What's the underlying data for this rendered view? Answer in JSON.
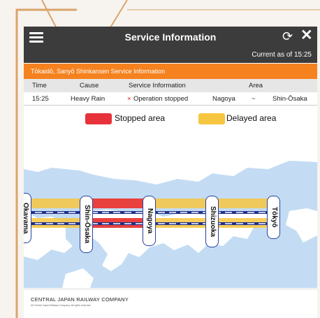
{
  "header": {
    "title": "Service Information",
    "as_of": "Current as of 15:25",
    "menu_icon": "hamburger-icon",
    "refresh_icon": "refresh-icon",
    "close_icon": "close-icon",
    "bg_color": "#3c3c3c"
  },
  "banner": {
    "text": "Tōkaidō, Sanyō Shinkansen Service Information",
    "color": "#f5821f"
  },
  "table": {
    "headers": [
      "Time",
      "Cause",
      "Service Information",
      "Area"
    ],
    "row": {
      "time": "15:25",
      "cause": "Heavy Rain",
      "mark": "×",
      "info": "Operation stopped",
      "area_from": "Nagoya",
      "area_sep": "~",
      "area_to": "Shin-Ōsaka"
    }
  },
  "legend": {
    "stopped": "Stopped area",
    "delayed": "Delayed area",
    "stopped_color": "#e8323a",
    "delayed_color": "#f7c640"
  },
  "map": {
    "stations": [
      "Okayama",
      "Shin-Ōsaka",
      "Nagoya",
      "Shizuoka",
      "Tōkyō"
    ],
    "sea_color": "#c3dcf4",
    "land_color": "#ffffff"
  },
  "footer": {
    "company": "CENTRAL JAPAN RAILWAY COMPANY",
    "copyright": "All Central Japan Railway Company. All rights reserved."
  }
}
